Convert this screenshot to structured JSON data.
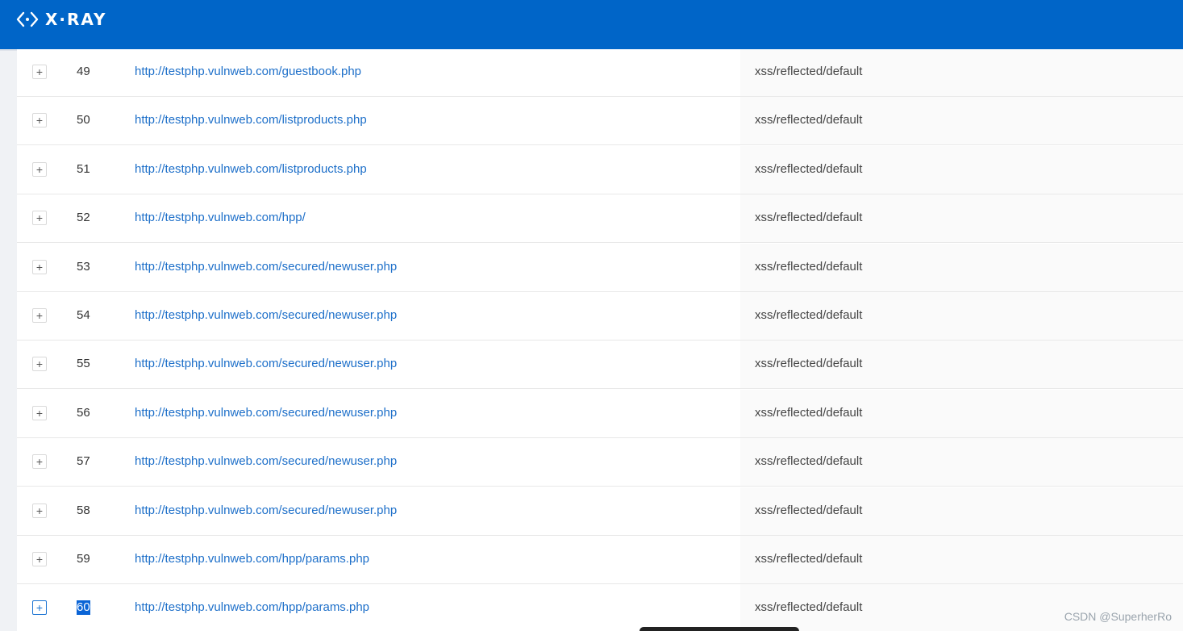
{
  "app": {
    "logo_text": "X·RAY"
  },
  "rows": [
    {
      "index": "49",
      "url": "http://testphp.vulnweb.com/guestbook.php",
      "plugin": "xss/reflected/default"
    },
    {
      "index": "50",
      "url": "http://testphp.vulnweb.com/listproducts.php",
      "plugin": "xss/reflected/default"
    },
    {
      "index": "51",
      "url": "http://testphp.vulnweb.com/listproducts.php",
      "plugin": "xss/reflected/default"
    },
    {
      "index": "52",
      "url": "http://testphp.vulnweb.com/hpp/",
      "plugin": "xss/reflected/default"
    },
    {
      "index": "53",
      "url": "http://testphp.vulnweb.com/secured/newuser.php",
      "plugin": "xss/reflected/default"
    },
    {
      "index": "54",
      "url": "http://testphp.vulnweb.com/secured/newuser.php",
      "plugin": "xss/reflected/default"
    },
    {
      "index": "55",
      "url": "http://testphp.vulnweb.com/secured/newuser.php",
      "plugin": "xss/reflected/default"
    },
    {
      "index": "56",
      "url": "http://testphp.vulnweb.com/secured/newuser.php",
      "plugin": "xss/reflected/default"
    },
    {
      "index": "57",
      "url": "http://testphp.vulnweb.com/secured/newuser.php",
      "plugin": "xss/reflected/default"
    },
    {
      "index": "58",
      "url": "http://testphp.vulnweb.com/secured/newuser.php",
      "plugin": "xss/reflected/default"
    },
    {
      "index": "59",
      "url": "http://testphp.vulnweb.com/hpp/params.php",
      "plugin": "xss/reflected/default"
    },
    {
      "index": "60",
      "url": "http://testphp.vulnweb.com/hpp/params.php",
      "plugin": "xss/reflected/default"
    }
  ],
  "expand_symbol": "+",
  "watermark": "CSDN @SuperherRo",
  "colors": {
    "header": "#0065c8",
    "link": "#1d6fc9",
    "selection": "#0a64d6"
  }
}
